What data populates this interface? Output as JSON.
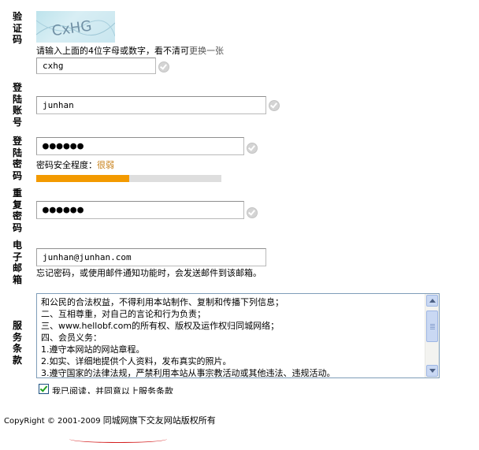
{
  "captcha": {
    "label": [
      "验",
      "证",
      "码"
    ],
    "image_text": "CxHG",
    "hint_text": "请输入上面的4位字母或数字，看不清可",
    "refresh_link": "更换一张",
    "input_value": "cxhg"
  },
  "account": {
    "label": [
      "登",
      "陆",
      "账",
      "号"
    ],
    "input_value": "junhan"
  },
  "password": {
    "label": [
      "登",
      "陆",
      "密",
      "码"
    ],
    "input_value": "●●●●●●",
    "strength_label": "密码安全程度：",
    "strength_value": "很弱",
    "strength_fraction": 0.5
  },
  "confirm_password": {
    "label": [
      "重",
      "复",
      "密",
      "码"
    ],
    "input_value": "●●●●●●"
  },
  "email": {
    "label": [
      "电",
      "子",
      "邮",
      "箱"
    ],
    "input_value": "junhan@junhan.com",
    "hint_text": "忘记密码，或使用邮件通知功能时，会发送邮件到该邮箱。"
  },
  "terms": {
    "label": [
      "服",
      "务",
      "条",
      "款"
    ],
    "lines": [
      "和公民的合法权益，不得利用本站制作、复制和传播下列信息；",
      "二、互相尊重，对自己的言论和行为负责；",
      "三、www.hellobf.com的所有权、版权及运作权归同城网络；",
      "四、会员义务：",
      "1.遵守本网站的网站章程。",
      "2.如实、详细地提供个人资料，发布真实的照片。",
      "3.遵守国家的法律法规，严禁利用本站从事宗教活动或其他违法、违规活动。"
    ],
    "agree_text": "我已阅读，并同意以上服务条款",
    "agree_checked": true
  },
  "footer": {
    "copyright": "CopyRight © 2001-2009",
    "owner": "同城网旗下交友网站版权所有"
  },
  "colors": {
    "strength_bar": "#f39a00",
    "strength_track": "#dedede",
    "strength_text": "#c8811a",
    "underline": "#d42020"
  }
}
